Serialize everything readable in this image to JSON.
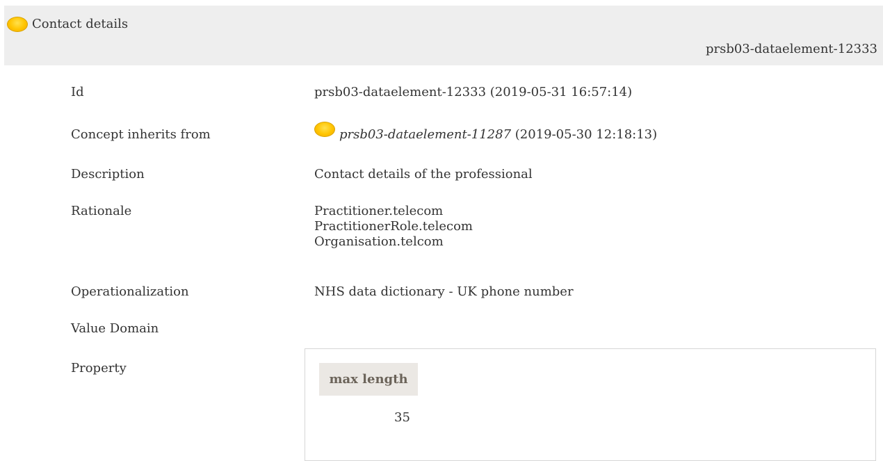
{
  "header": {
    "title": "Contact details",
    "id": "prsb03-dataelement-12333",
    "icon": "concept-status-icon",
    "icon_color": "#ffc400"
  },
  "rows": {
    "id": {
      "label": "Id",
      "value": "prsb03-dataelement-12333 (2019-05-31 16:57:14)"
    },
    "inherits": {
      "label": "Concept inherits from",
      "link": "prsb03-dataelement-11287",
      "date": " (2019-05-30 12:18:13)"
    },
    "description": {
      "label": "Description",
      "value": "Contact details of the professional"
    },
    "rationale": {
      "label": "Rationale",
      "lines": [
        "Practitioner.telecom",
        "PractitionerRole.telecom",
        "Organisation.telcom"
      ]
    },
    "operationalization": {
      "label": "Operationalization",
      "value": "NHS data dictionary - UK phone number"
    },
    "value_domain": {
      "label": "Value Domain"
    },
    "property": {
      "label": "Property",
      "header": "max length",
      "value": "35"
    }
  }
}
